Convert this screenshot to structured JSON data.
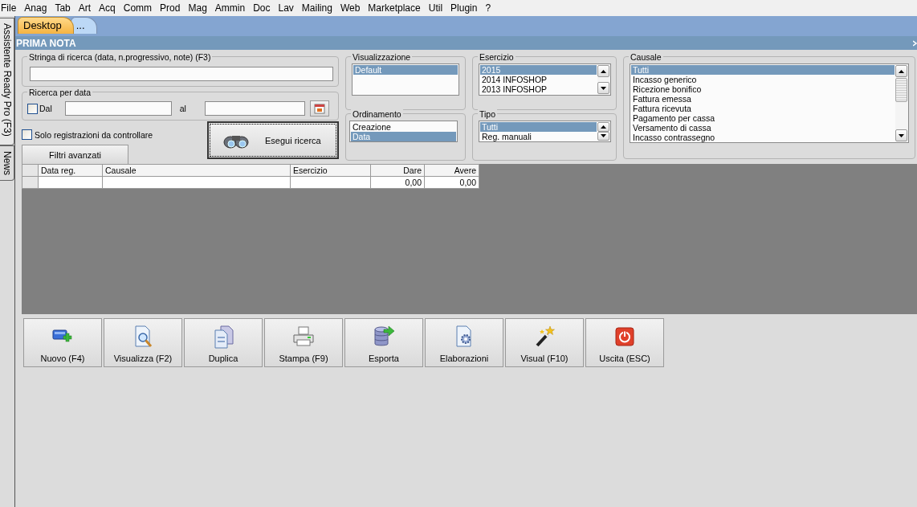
{
  "menu": [
    {
      "label": "File"
    },
    {
      "label": "Anag"
    },
    {
      "label": "Tab"
    },
    {
      "label": "Art"
    },
    {
      "label": "Acq"
    },
    {
      "label": "Comm"
    },
    {
      "label": "Prod"
    },
    {
      "label": "Mag"
    },
    {
      "label": "Ammin"
    },
    {
      "label": "Doc"
    },
    {
      "label": "Lav"
    },
    {
      "label": "Mailing"
    },
    {
      "label": "Web"
    },
    {
      "label": "Marketplace"
    },
    {
      "label": "Util"
    },
    {
      "label": "Plugin"
    },
    {
      "label": "?"
    }
  ],
  "side_tabs": [
    {
      "label": "Assistente Ready Pro (F3)",
      "selected": true
    },
    {
      "label": "News",
      "selected": false
    }
  ],
  "tabs": [
    {
      "label": "Desktop",
      "selected": true
    },
    {
      "label": "...",
      "selected": false
    }
  ],
  "panel_title": "PRIMA NOTA",
  "search": {
    "label": "Stringa di ricerca (data, n.progressivo, note) (F3)"
  },
  "date_search": {
    "label": "Ricerca per data",
    "from_label": "Dal",
    "from_checked": false,
    "to_label": "al"
  },
  "only_to_check": {
    "label": "Solo registrazioni da controllare",
    "checked": false
  },
  "advanced_filters_button": "Filtri avanzati",
  "search_button": "Esegui ricerca",
  "visualizzazione": {
    "label": "Visualizzazione",
    "items": [
      {
        "label": "Default",
        "selected": true
      }
    ]
  },
  "ordinamento": {
    "label": "Ordinamento",
    "items": [
      {
        "label": "Creazione",
        "selected": false
      },
      {
        "label": "Data",
        "selected": true
      }
    ]
  },
  "esercizio": {
    "label": "Esercizio",
    "items": [
      {
        "label": "2015",
        "selected": true
      },
      {
        "label": "2014 INFOSHOP",
        "selected": false
      },
      {
        "label": "2013 INFOSHOP",
        "selected": false
      }
    ]
  },
  "tipo": {
    "label": "Tipo",
    "items": [
      {
        "label": "Tutti",
        "selected": true
      },
      {
        "label": "Reg. manuali",
        "selected": false
      }
    ]
  },
  "causale": {
    "label": "Causale",
    "items": [
      {
        "label": "Tutti",
        "selected": true
      },
      {
        "label": "Incasso generico",
        "selected": false
      },
      {
        "label": "Ricezione bonifico",
        "selected": false
      },
      {
        "label": "Fattura emessa",
        "selected": false
      },
      {
        "label": "Fattura ricevuta",
        "selected": false
      },
      {
        "label": "Pagamento per cassa",
        "selected": false
      },
      {
        "label": "Versamento di cassa",
        "selected": false
      },
      {
        "label": "Incasso contrassegno",
        "selected": false
      }
    ]
  },
  "table": {
    "columns": [
      {
        "label": "Data reg.",
        "kind": "text"
      },
      {
        "label": "Causale",
        "kind": "text"
      },
      {
        "label": "Esercizio",
        "kind": "text"
      },
      {
        "label": "Dare",
        "kind": "amount"
      },
      {
        "label": "Avere",
        "kind": "amount"
      }
    ],
    "rows": [
      {
        "amounts": [
          "0,00",
          "0,00"
        ]
      }
    ]
  },
  "toolbar": [
    {
      "label": "Nuovo (F4)"
    },
    {
      "label": "Visualizza (F2)"
    },
    {
      "label": "Duplica"
    },
    {
      "label": "Stampa (F9)"
    },
    {
      "label": "Esporta"
    },
    {
      "label": "Elaborazioni"
    },
    {
      "label": "Visual (F10)"
    },
    {
      "label": "Uscita (ESC)"
    }
  ]
}
